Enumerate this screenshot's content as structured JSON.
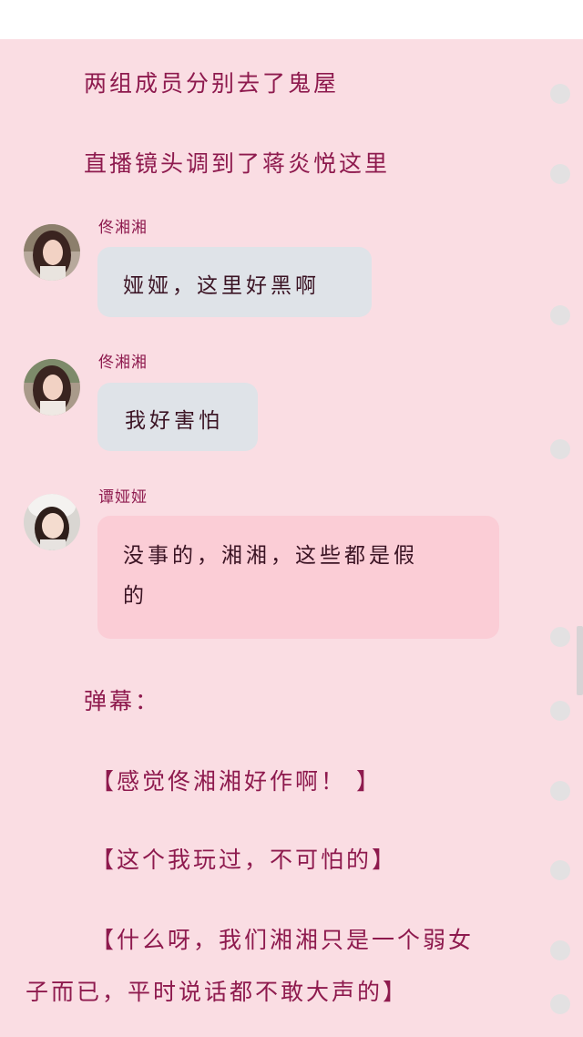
{
  "narration": {
    "line1": "两组成员分别去了鬼屋",
    "line2": "直播镜头调到了蒋炎悦这里"
  },
  "messages": [
    {
      "speaker": "佟湘湘",
      "text": "娅娅，这里好黑啊",
      "avatar_icon": "girl-avatar-icon"
    },
    {
      "speaker": "佟湘湘",
      "text": "我好害怕",
      "avatar_icon": "girl-avatar-icon"
    },
    {
      "speaker": "谭娅娅",
      "text_line1": "没事的，湘湘，这些都是假",
      "text_line2": "的",
      "avatar_icon": "girl-avatar-icon"
    }
  ],
  "danmaku": {
    "label": "弹幕：",
    "comment1": "【感觉佟湘湘好作啊！ 】",
    "comment2": "【这个我玩过，不可怕的】",
    "comment3_line1": "【什么呀，我们湘湘只是一个弱女",
    "comment3_line2": "子而已，平时说话都不敢大声的】"
  },
  "colors": {
    "page_background": "#fadde3",
    "narration_text": "#8e1a4e",
    "gray_bubble": "#dfe3e8",
    "pink_bubble": "#fbcdd6",
    "side_dot": "#e3e1e2"
  }
}
